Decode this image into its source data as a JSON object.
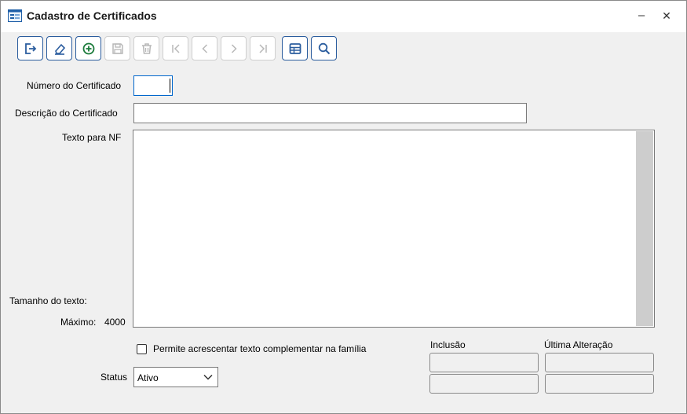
{
  "window": {
    "title": "Cadastro de Certificados",
    "minimize_glyph": "–",
    "close_glyph": "✕"
  },
  "toolbar": {
    "buttons": [
      {
        "name": "exit-button",
        "icon": "exit-icon",
        "enabled": true
      },
      {
        "name": "clear-button",
        "icon": "eraser-icon",
        "enabled": true
      },
      {
        "name": "add-button",
        "icon": "plus-circle-icon",
        "enabled": true
      },
      {
        "name": "save-button",
        "icon": "floppy-icon",
        "enabled": false
      },
      {
        "name": "delete-button",
        "icon": "trash-icon",
        "enabled": false
      },
      {
        "name": "first-record-button",
        "icon": "first-icon",
        "enabled": false
      },
      {
        "name": "previous-record-button",
        "icon": "chevron-left-icon",
        "enabled": false
      },
      {
        "name": "next-record-button",
        "icon": "chevron-right-icon",
        "enabled": false
      },
      {
        "name": "last-record-button",
        "icon": "last-icon",
        "enabled": false
      },
      {
        "name": "grid-view-button",
        "icon": "table-icon",
        "enabled": true
      },
      {
        "name": "search-button",
        "icon": "search-icon",
        "enabled": true
      }
    ],
    "accent_color": "#2b5d9e",
    "disabled_color": "#cfcfcf"
  },
  "form": {
    "numero_label": "Número do Certificado",
    "numero_value": "",
    "descricao_label": "Descrição do Certificado",
    "descricao_value": "",
    "texto_label": "Texto para NF",
    "texto_value": "",
    "tamanho_label": "Tamanho do texto:",
    "maximo_label": "Máximo:",
    "maximo_value": "4000",
    "checkbox_label": "Permite acrescentar texto complementar na família",
    "checkbox_checked": false,
    "status_label": "Status",
    "status_value": "Ativo",
    "inclusao_label": "Inclusão",
    "alteracao_label": "Última Alteração"
  }
}
